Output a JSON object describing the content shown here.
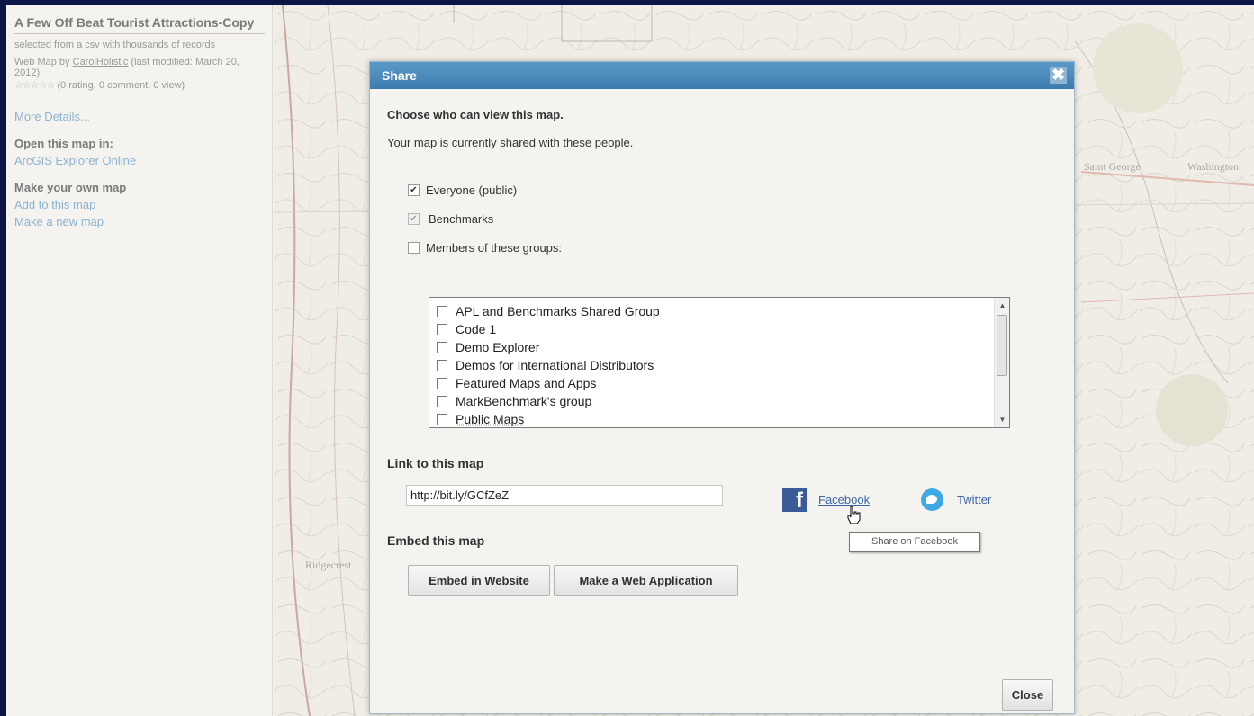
{
  "sidebar": {
    "title": "A Few Off Beat Tourist Attractions-Copy",
    "description": "selected from a csv with thousands of records",
    "meta_prefix": "Web Map by",
    "owner": "CarolHolistic",
    "meta_suffix": "(last modified: March 20, 2012)",
    "rating_stars": "☆☆☆☆☆",
    "rating_text": "(0 rating, 0 comment, 0 view)",
    "more_details": "More Details...",
    "open_heading": "Open this map in:",
    "open_link": "ArcGIS Explorer Online",
    "make_heading": "Make your own map",
    "add_link": "Add to this map",
    "new_link": "Make a new map"
  },
  "map": {
    "labels": [
      "Saint George",
      "Washington",
      "Ridgecrest"
    ]
  },
  "dialog": {
    "title": "Share",
    "close_icon": "✖",
    "heading": "Choose who can view this map.",
    "subheading": "Your map is currently shared with these people.",
    "options": {
      "everyone": {
        "label": "Everyone (public)",
        "checked": true
      },
      "benchmarks": {
        "label": "Benchmarks",
        "checked": true,
        "disabled": true
      },
      "members": {
        "label": "Members of these groups:",
        "checked": false
      }
    },
    "groups": [
      "APL and Benchmarks Shared Group",
      "Code 1",
      "Demo Explorer",
      "Demos for International Distributors",
      "Featured Maps and Apps",
      "MarkBenchmark's group",
      "Public Maps"
    ],
    "link_heading": "Link to this map",
    "link_url": "http://bit.ly/GCfZeZ",
    "facebook_label": "Facebook",
    "twitter_label": "Twitter",
    "tooltip": "Share on Facebook",
    "embed_heading": "Embed this map",
    "embed_button": "Embed in Website",
    "webapp_button": "Make a Web Application",
    "close_button": "Close"
  },
  "colors": {
    "titlebar": "#3c7cad",
    "facebook": "#3b5b98",
    "twitter": "#3fa9e5",
    "link": "#3a67a6"
  }
}
